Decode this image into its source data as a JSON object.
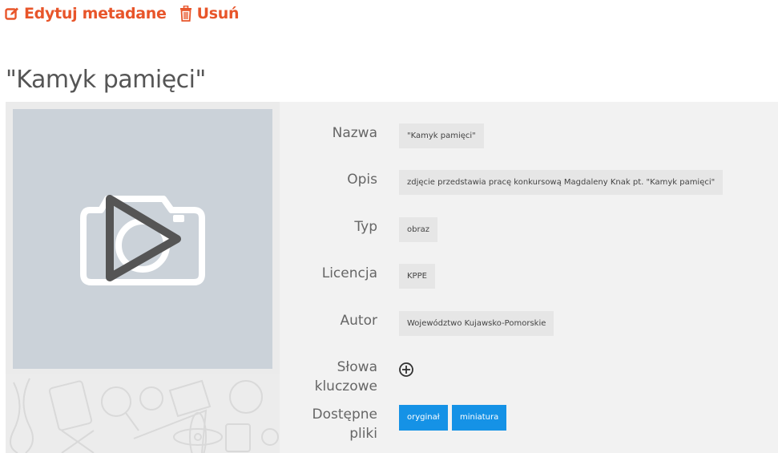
{
  "toolbar": {
    "edit_label": "Edytuj metadane",
    "delete_label": "Usuń"
  },
  "page": {
    "title": "\"Kamyk pamięci\""
  },
  "metadata": {
    "name_label": "Nazwa",
    "name_value": "\"Kamyk pamięci\"",
    "description_label": "Opis",
    "description_value": "zdjęcie przedstawia pracę konkursową Magdaleny Knak pt. \"Kamyk pamięci\"",
    "type_label": "Typ",
    "type_value": "obraz",
    "license_label": "Licencja",
    "license_value": "KPPE",
    "author_label": "Autor",
    "author_value": "Województwo Kujawsko-Pomorskie",
    "keywords_label_line1": "Słowa",
    "keywords_label_line2": "kluczowe",
    "files_label_line1": "Dostępne",
    "files_label_line2": "pliki",
    "files": [
      "oryginał",
      "miniatura"
    ]
  },
  "colors": {
    "accent": "#e8552a",
    "button_blue": "#1592e6",
    "panel_bg": "#f2f2f2",
    "preview_bg": "#cbd2d9"
  },
  "icons": {
    "edit": "edit-square-icon",
    "delete": "trash-icon",
    "preview": "camera-play-icon",
    "add_keyword": "plus-circle-icon"
  }
}
